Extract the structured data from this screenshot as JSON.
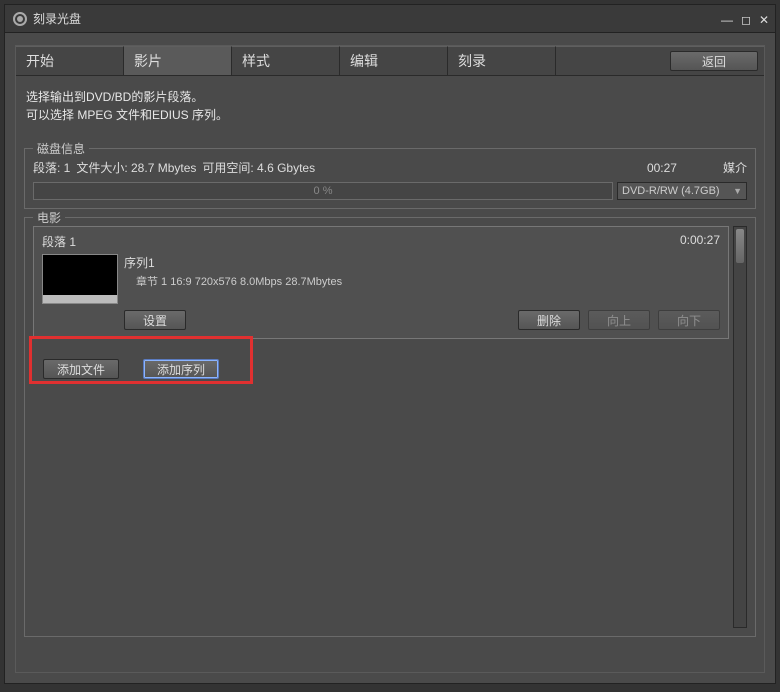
{
  "window": {
    "title": "刻录光盘"
  },
  "tabs": {
    "items": [
      {
        "label": "开始"
      },
      {
        "label": "影片"
      },
      {
        "label": "样式"
      },
      {
        "label": "编辑"
      },
      {
        "label": "刻录"
      }
    ],
    "active_index": 1,
    "return_label": "返回"
  },
  "description": {
    "line1": "选择输出到DVD/BD的影片段落。",
    "line2": "可以选择 MPEG 文件和EDIUS 序列。"
  },
  "disk": {
    "legend": "磁盘信息",
    "segments_label": "段落: 1",
    "filesize_label": "文件大小: 28.7 Mbytes",
    "freespace_label": "可用空间: 4.6 Gbytes",
    "time": "00:27",
    "media_label": "媒介",
    "progress_text": "0 %",
    "media_selected": "DVD-R/RW (4.7GB)"
  },
  "movie": {
    "legend": "电影",
    "segment": {
      "name": "段落 1",
      "duration": "0:00:27",
      "seq_title": "序列1",
      "meta": "章节 1   16:9   720x576   8.0Mbps   28.7Mbytes",
      "settings_label": "设置",
      "delete_label": "删除",
      "up_label": "向上",
      "down_label": "向下"
    },
    "add_file_label": "添加文件",
    "add_sequence_label": "添加序列"
  }
}
